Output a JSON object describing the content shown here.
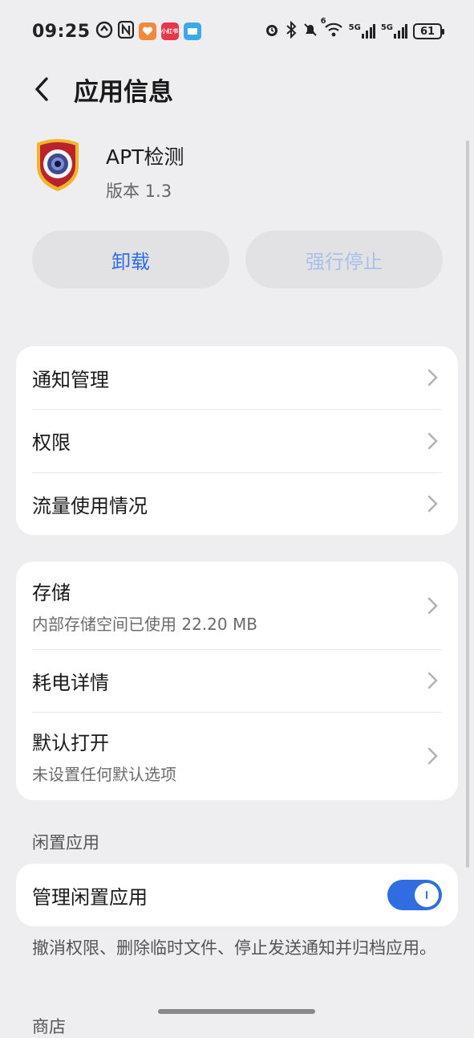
{
  "status_bar": {
    "time": "09:25",
    "battery": "61",
    "signal_1": "5G",
    "signal_2": "5G",
    "wifi_badge": "6",
    "notif_app_label": "小红书"
  },
  "header": {
    "title": "应用信息"
  },
  "app": {
    "name": "APT检测",
    "version": "版本 1.3"
  },
  "buttons": {
    "uninstall": "卸载",
    "force_stop": "强行停止"
  },
  "card1": {
    "items": [
      {
        "title": "通知管理"
      },
      {
        "title": "权限"
      },
      {
        "title": "流量使用情况"
      }
    ]
  },
  "card2": {
    "items": [
      {
        "title": "存储",
        "subtitle": "内部存储空间已使用 22.20 MB"
      },
      {
        "title": "耗电详情"
      },
      {
        "title": "默认打开",
        "subtitle": "未设置任何默认选项"
      }
    ]
  },
  "idle": {
    "section_label": "闲置应用",
    "manage_label": "管理闲置应用",
    "toggle_on": true,
    "description": "撤消权限、删除临时文件、停止发送通知并归档应用。"
  },
  "store": {
    "section_label": "商店"
  },
  "colors": {
    "accent": "#2f6de1",
    "accent_disabled": "#a9c0ec",
    "background": "#eeeef0"
  }
}
